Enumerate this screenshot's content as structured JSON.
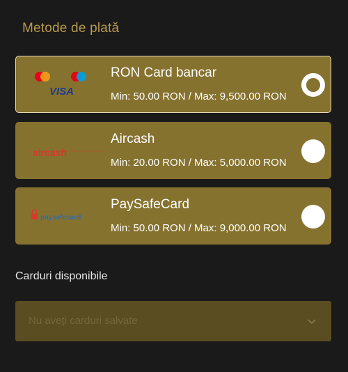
{
  "section_title": "Metode de plată",
  "methods": [
    {
      "name": "RON Card bancar",
      "limits": "Min: 50.00 RON / Max: 9,500.00 RON",
      "selected": true,
      "logo": {
        "icon": "mastercard-maestro-visa-icon",
        "text": "VISA",
        "color": "#1a3a8f"
      }
    },
    {
      "name": "Aircash",
      "limits": "Min: 20.00 RON / Max: 5,000.00 RON",
      "selected": false,
      "logo": {
        "icon": "aircash-logo-icon",
        "text": "aircash",
        "color": "#d63a2a"
      }
    },
    {
      "name": "PaySafeCard",
      "limits": "Min: 50.00 RON / Max: 9,000.00 RON",
      "selected": false,
      "logo": {
        "icon": "paysafecard-logo-icon",
        "text": "paysafecard",
        "color": "#2a6fb4"
      }
    }
  ],
  "cards_section": {
    "label": "Carduri disponibile",
    "placeholder": "Nu aveți carduri salvate"
  },
  "colors": {
    "background": "#1a1a1a",
    "accent": "#86722f",
    "title": "#b89a4f"
  }
}
